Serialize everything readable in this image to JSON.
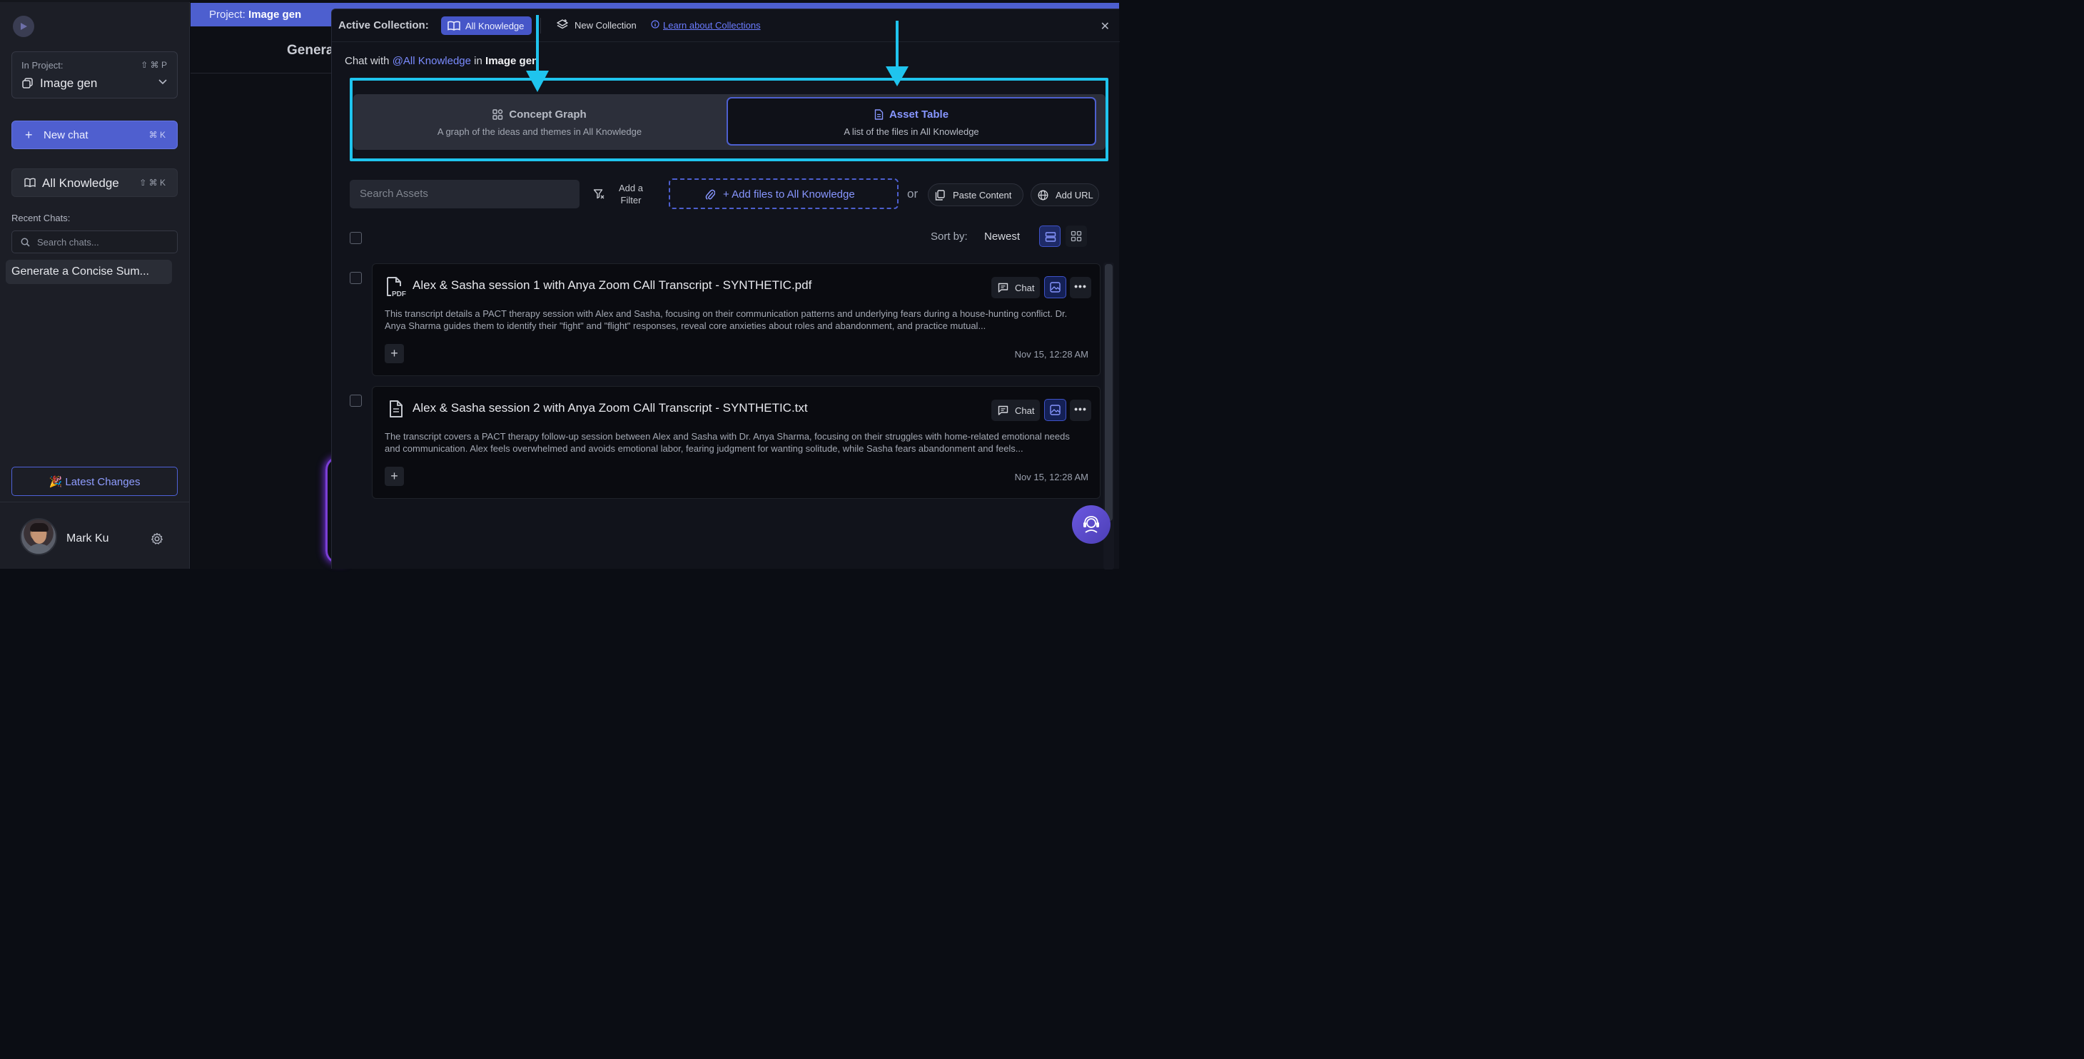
{
  "sidebar": {
    "project_label": "In Project:",
    "project_shortcut": "⇧ ⌘ P",
    "project_name": "Image gen",
    "new_chat_label": "New chat",
    "new_chat_shortcut": "⌘ K",
    "all_knowledge_label": "All Knowledge",
    "all_knowledge_shortcut": "⇧ ⌘ K",
    "recent_chats_label": "Recent Chats:",
    "search_chats_placeholder": "Search chats...",
    "recent_chats": [
      "Generate a Concise Sum..."
    ],
    "latest_changes_label": "🎉 Latest Changes",
    "user_name": "Mark Ku"
  },
  "background": {
    "project_prefix": "Project:",
    "project_name": "Image gen",
    "chat_title": "Genera"
  },
  "modal": {
    "active_collection_label": "Active Collection:",
    "active_collection": "All Knowledge",
    "new_collection_label": "New Collection",
    "learn_link": "Learn about Collections",
    "chat_with_prefix": "Chat with",
    "chat_with_collection": "@All Knowledge",
    "chat_with_in": "in",
    "chat_with_project": "Image gen",
    "tabs": [
      {
        "title": "Concept Graph",
        "subtitle": "A graph of the ideas and themes in All Knowledge",
        "active": false
      },
      {
        "title": "Asset Table",
        "subtitle": "A list of the files in All Knowledge",
        "active": true
      }
    ],
    "search_assets_placeholder": "Search Assets",
    "filter_label_1": "Add a",
    "filter_label_2": "Filter",
    "add_files_label": "+ Add files to All Knowledge",
    "or_label": "or",
    "paste_content_label": "Paste Content",
    "add_url_label": "Add URL",
    "sort_by_label": "Sort by:",
    "sort_value": "Newest",
    "assets": [
      {
        "type": "pdf",
        "title": "Alex & Sasha session 1 with Anya Zoom CAll Transcript - SYNTHETIC.pdf",
        "description": "This transcript details a PACT therapy session with Alex and Sasha, focusing on their communication patterns and underlying fears during a house-hunting conflict. Dr. Anya Sharma guides them to identify their \"fight\" and \"flight\" responses, reveal core anxieties about roles and abandonment, and practice mutual...",
        "date": "Nov 15, 12:28 AM",
        "chat_label": "Chat"
      },
      {
        "type": "txt",
        "title": "Alex & Sasha session 2 with Anya Zoom CAll Transcript - SYNTHETIC.txt",
        "description": "The transcript covers a PACT therapy follow-up session between Alex and Sasha with Dr. Anya Sharma, focusing on their struggles with home-related emotional needs and communication. Alex feels overwhelmed and avoids emotional labor, fearing judgment for wanting solitude, while Sasha fears abandonment and feels...",
        "date": "Nov 15, 12:28 AM",
        "chat_label": "Chat"
      }
    ]
  },
  "colors": {
    "accent": "#4d5fcf",
    "highlight": "#1fc4ee",
    "link": "#7a8bff"
  }
}
